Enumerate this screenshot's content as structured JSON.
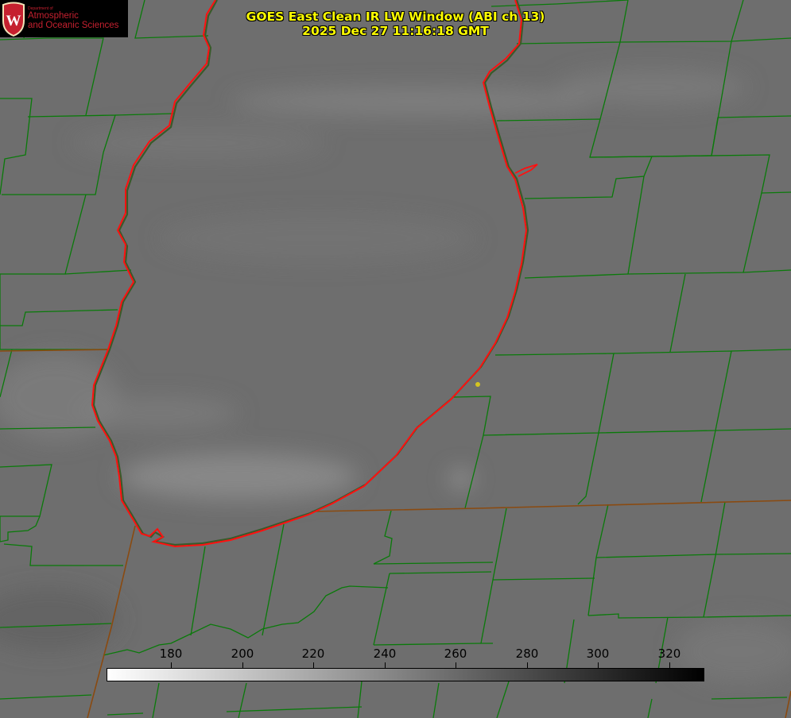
{
  "logo": {
    "department": "Department of",
    "line1": "Atmospheric",
    "line2": "and Oceanic Sciences",
    "shield_letter": "W",
    "color": "#c5202f"
  },
  "title": {
    "line1": "GOES East Clean IR LW Window (ABI ch 13)",
    "line2": "2025 Dec 27 11:16:18 GMT",
    "color": "#ffff00"
  },
  "colorbar": {
    "ticks": [
      "180",
      "200",
      "220",
      "240",
      "260",
      "280",
      "300",
      "320"
    ],
    "gradient_from": "#ffffff",
    "gradient_to": "#000000"
  },
  "map": {
    "background_color": "#6e6e6e",
    "coastline_color": "#ff1010",
    "county_border_color": "#0a7a0a",
    "state_border_color": "#8a4a10",
    "station_marker_color": "#d4c420"
  }
}
